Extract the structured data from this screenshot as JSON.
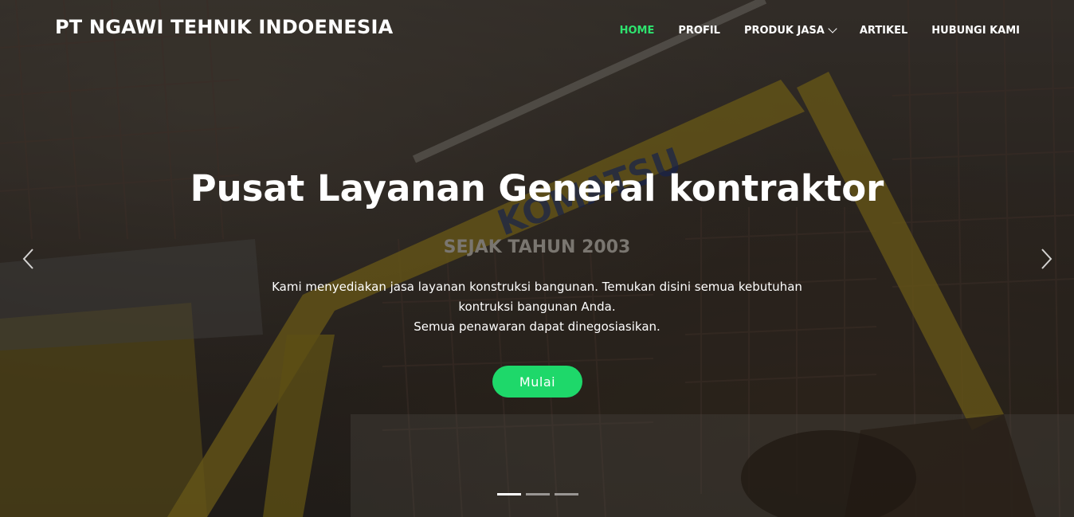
{
  "header": {
    "brand": "PT NGAWI TEHNIK INDOENESIA",
    "nav": [
      {
        "label": "HOME",
        "active": true
      },
      {
        "label": "PROFIL",
        "active": false
      },
      {
        "label": "PRODUK JASA",
        "active": false,
        "dropdown": true
      },
      {
        "label": "ARTIKEL",
        "active": false
      },
      {
        "label": "HUBUNGI KAMI",
        "active": false
      }
    ]
  },
  "hero": {
    "title": "Pusat Layanan General kontraktor",
    "subtitle": "SEJAK TAHUN 2003",
    "description_line1": "Kami menyediakan jasa layanan konstruksi bangunan. Temukan disini semua kebutuhan",
    "description_line2": "kontruksi bangunan Anda.",
    "description_line3": "Semua penawaran dapat dinegosiasikan.",
    "cta_label": "Mulai",
    "excavator_brand_text": "KOMATSU",
    "slides": 3,
    "active_slide": 1
  },
  "colors": {
    "accent": "#1ed86a",
    "nav_active": "#2ee36f",
    "subtitle": "#7a7670"
  },
  "icons": {
    "prev": "chevron-left-icon",
    "next": "chevron-right-icon",
    "dropdown": "chevron-down-icon"
  }
}
